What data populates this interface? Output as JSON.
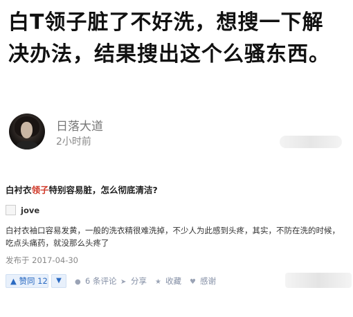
{
  "post": {
    "headline": "白T领子脏了不好洗，想搜一下解决办法，结果搜出这个么骚东西。",
    "author": "日落大道",
    "time": "2小时前"
  },
  "question": {
    "title_pre": "白衬衣",
    "title_highlight": "领子",
    "title_post": "特别容易脏，怎么彻底清洁?",
    "highlight_color": "#d03a2a"
  },
  "answer": {
    "author": "jove",
    "body": "白衬衣袖口容易发黄，一般的洗衣精很难洗掉，不少人为此感到头疼，其实，不防在洗的时候，吃点头痛药，就没那么头疼了",
    "date": "发布于 2017-04-30"
  },
  "actions": {
    "upvote_label": "▲ 赞同 12",
    "downvote_label": "▼",
    "comments": "6 条评论",
    "share": "分享",
    "collect": "收藏",
    "thanks": "感谢",
    "accent_color": "#2a6ac2"
  },
  "icons": {
    "comment": "speech-bubble-icon",
    "share": "paper-plane-icon",
    "collect": "star-icon",
    "thanks": "heart-icon"
  }
}
